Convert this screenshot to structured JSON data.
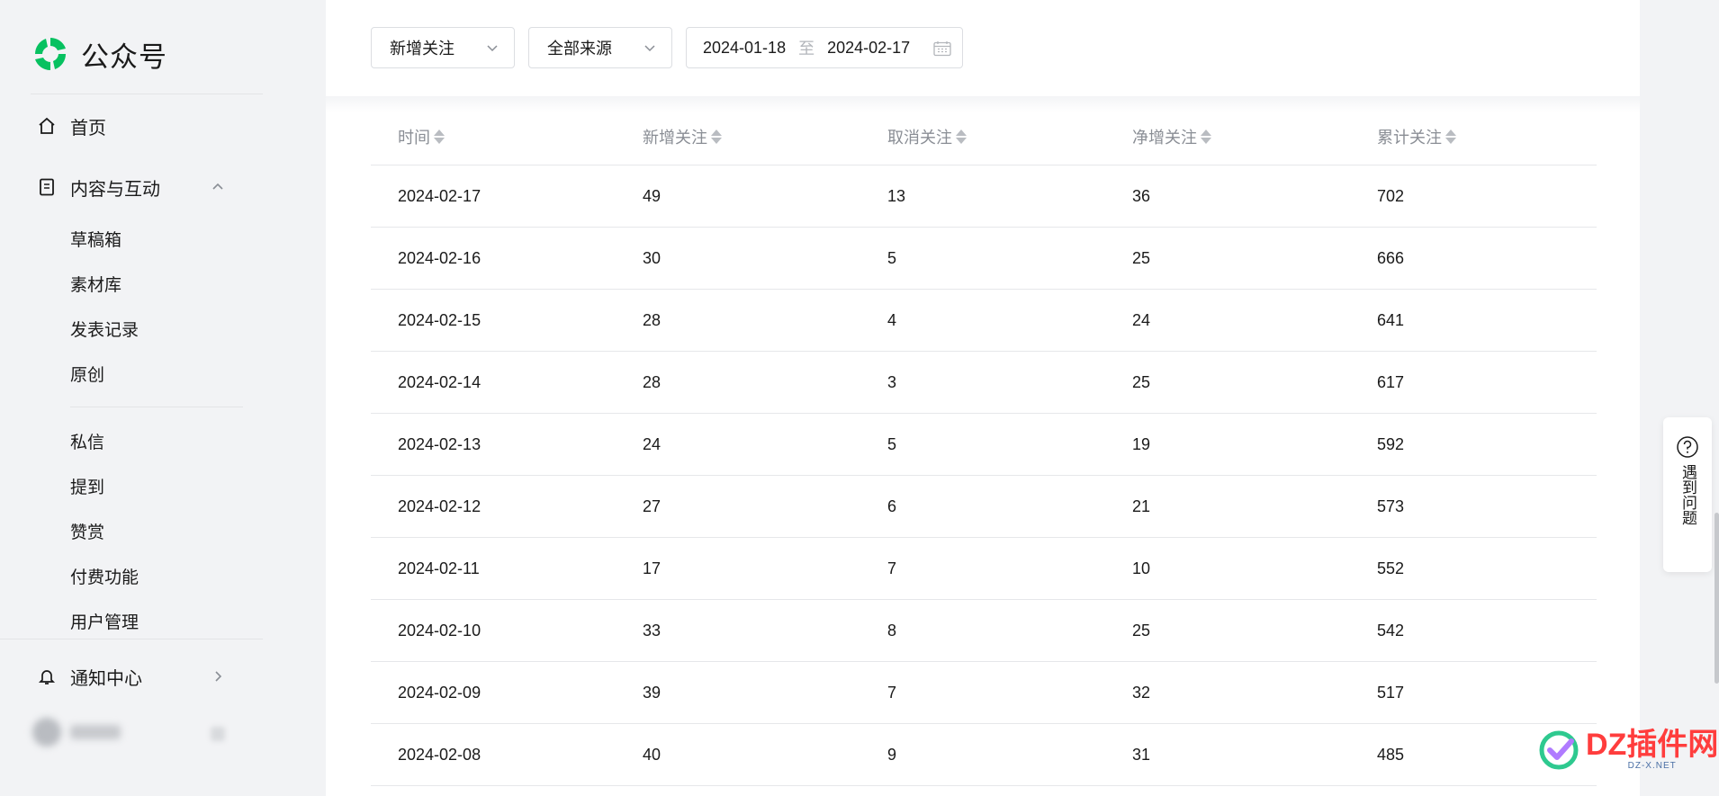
{
  "app": {
    "title": "公众号"
  },
  "sidebar": {
    "home_label": "首页",
    "content_group_label": "内容与互动",
    "content_items": [
      "草稿箱",
      "素材库",
      "发表记录",
      "原创"
    ],
    "interaction_items": [
      "私信",
      "提到",
      "赞赏",
      "付费功能",
      "用户管理"
    ],
    "notice_label": "通知中心"
  },
  "filters": {
    "type_select": "新增关注",
    "source_select": "全部来源",
    "date_start": "2024-01-18",
    "date_separator": "至",
    "date_end": "2024-02-17"
  },
  "table": {
    "headers": [
      "时间",
      "新增关注",
      "取消关注",
      "净增关注",
      "累计关注"
    ],
    "rows": [
      [
        "2024-02-17",
        "49",
        "13",
        "36",
        "702"
      ],
      [
        "2024-02-16",
        "30",
        "5",
        "25",
        "666"
      ],
      [
        "2024-02-15",
        "28",
        "4",
        "24",
        "641"
      ],
      [
        "2024-02-14",
        "28",
        "3",
        "25",
        "617"
      ],
      [
        "2024-02-13",
        "24",
        "5",
        "19",
        "592"
      ],
      [
        "2024-02-12",
        "27",
        "6",
        "21",
        "573"
      ],
      [
        "2024-02-11",
        "17",
        "7",
        "10",
        "552"
      ],
      [
        "2024-02-10",
        "33",
        "8",
        "25",
        "542"
      ],
      [
        "2024-02-09",
        "39",
        "7",
        "32",
        "517"
      ],
      [
        "2024-02-08",
        "40",
        "9",
        "31",
        "485"
      ]
    ]
  },
  "help": {
    "label": "遇到问题"
  },
  "watermark": {
    "main": "DZ插件网",
    "sub": "DZ-X.NET"
  },
  "colors": {
    "brand_green": "#07c160",
    "sort_arrow": "#b9bcc1",
    "watermark_red": "#ff3d3d"
  }
}
